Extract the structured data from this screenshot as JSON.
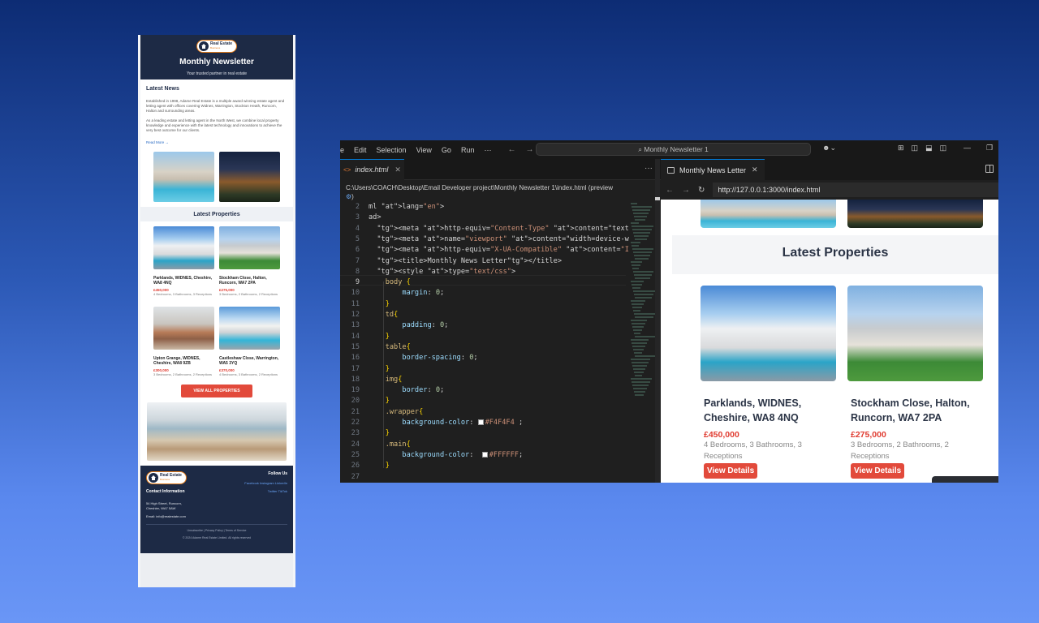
{
  "newsletter": {
    "brand_line1": "Real Estate",
    "brand_line2": "Business",
    "title": "Monthly Newsletter",
    "subtitle": "Your trusted partner in real estate",
    "latest_news_heading": "Latest News",
    "para1": "Established in 1998, Adame Real Estate is a multiple award winning estate agent and letting agent with offices covering Widnes, Warrington, Stockton Heath, Runcorn, Halton and surrounding areas.",
    "para2": "As a leading estate and letting agent in the North West, we combine local property knowledge and experience with the latest technology and innovations to achieve the very best outcome for our clients.",
    "read_more": "Read More →",
    "latest_properties_heading": "Latest Properties",
    "properties": [
      {
        "name": "Parklands, WIDNES, Cheshire, WA8 4NQ",
        "price": "£450,000",
        "details": "4 Bedrooms, 3 Bathrooms, 3 Receptions"
      },
      {
        "name": "Stockham Close, Halton, Runcorn, WA7 2PA",
        "price": "£275,000",
        "details": "3 Bedrooms, 2 Bathrooms, 2 Receptions"
      },
      {
        "name": "Upton Grange, WIDNES, Cheshire, WA8 9ZB",
        "price": "£300,000",
        "details": "3 Bedrooms, 2 Bathrooms, 2 Receptions"
      },
      {
        "name": "Castleshaw Close, Warrington, WA5 3YQ",
        "price": "£370,000",
        "details": "4 Bedrooms, 3 Bathrooms, 2 Receptions"
      }
    ],
    "view_all": "VIEW ALL PROPERTIES",
    "footer": {
      "follow_us": "Follow Us",
      "contact_heading": "Contact Information",
      "social_links_1": "Facebook  Instagram  LinkedIn",
      "social_links_2": "Twitter  TikTok",
      "address_1": "54 High Street, Runcorn,",
      "address_2": "Cheshire, WA7 5AW",
      "email": "Email: info@realestate.com",
      "legal_links": "Unsubscribe | Privacy Policy | Terms of Service",
      "copyright": "© 2024 Adame Real Estate Limited. All rights reserved"
    }
  },
  "vscode": {
    "menu": [
      "e",
      "Edit",
      "Selection",
      "View",
      "Go",
      "Run",
      "···"
    ],
    "search_text": "⌕ Monthly Newsletter 1",
    "editor_tab": "index.html",
    "breadcrumb": "C:\\Users\\COACH\\Desktop\\Email Developer project\\Monthly Newsletter 1\\index.html (preview",
    "breadcrumb_tail": ")",
    "line_numbers": [
      "2",
      "3",
      "4",
      "5",
      "6",
      "7",
      "8",
      "9",
      "10",
      "11",
      "12",
      "13",
      "14",
      "15",
      "16",
      "17",
      "18",
      "19",
      "20",
      "21",
      "22",
      "23",
      "24",
      "25",
      "26",
      "27"
    ],
    "code_lines": [
      "ml lang=\"en\">",
      "ad>",
      "  <meta http-equiv=\"Content-Type\" content=\"text/html; charse",
      "  <meta name=\"viewport\" content=\"width=device-width, initia",
      "  <meta http-equiv=\"X-UA-Compatible\" content=\"IE=edge\" />",
      "  <title>Monthly News Letter</title>",
      "  <style type=\"text/css\">",
      "    body {",
      "        margin: 0;",
      "    }",
      "    td{",
      "        padding: 0;",
      "    }",
      "    table{",
      "        border-spacing: 0;",
      "    }",
      "    img{",
      "        border: 0;",
      "    }",
      "    .wrapper{",
      "        background-color: #F4F4F4 ;",
      "    }",
      "    .main{",
      "        background-color:  #FFFFFF;",
      "    }",
      ""
    ],
    "browser_tab": "Monthly News Letter",
    "url": "http://127.0.0.1:3000/index.html",
    "preview_heading": "Latest Properties",
    "preview_cards": [
      {
        "name": "Parklands, WIDNES, Cheshire, WA8 4NQ",
        "price": "£450,000",
        "details": "4 Bedrooms, 3 Bathrooms, 3 Receptions",
        "button": "View Details"
      },
      {
        "name": "Stockham Close, Halton, Runcorn, WA7 2PA",
        "price": "£275,000",
        "details": "3 Bedrooms, 2 Bathrooms, 2 Receptions",
        "button": "View Details"
      }
    ]
  }
}
